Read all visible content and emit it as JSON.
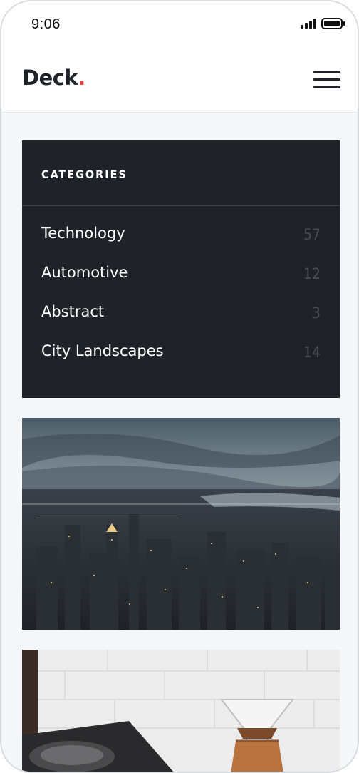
{
  "status_bar": {
    "time": "9:06",
    "icons": [
      "signal-icon",
      "battery-icon"
    ]
  },
  "header": {
    "logo_text": "Deck",
    "logo_dot": ".",
    "menu_icon": "hamburger-menu-icon",
    "accent_color": "#e5474b"
  },
  "categories": {
    "title": "CATEGORIES",
    "items": [
      {
        "name": "Technology",
        "count": "57"
      },
      {
        "name": "Automotive",
        "count": "12"
      },
      {
        "name": "Abstract",
        "count": "3"
      },
      {
        "name": "City Landscapes",
        "count": "14"
      }
    ],
    "background_color": "#1f2229"
  },
  "posts": [
    {
      "image": "city-skyline-photo"
    },
    {
      "image": "coffee-pour-over-photo"
    }
  ]
}
